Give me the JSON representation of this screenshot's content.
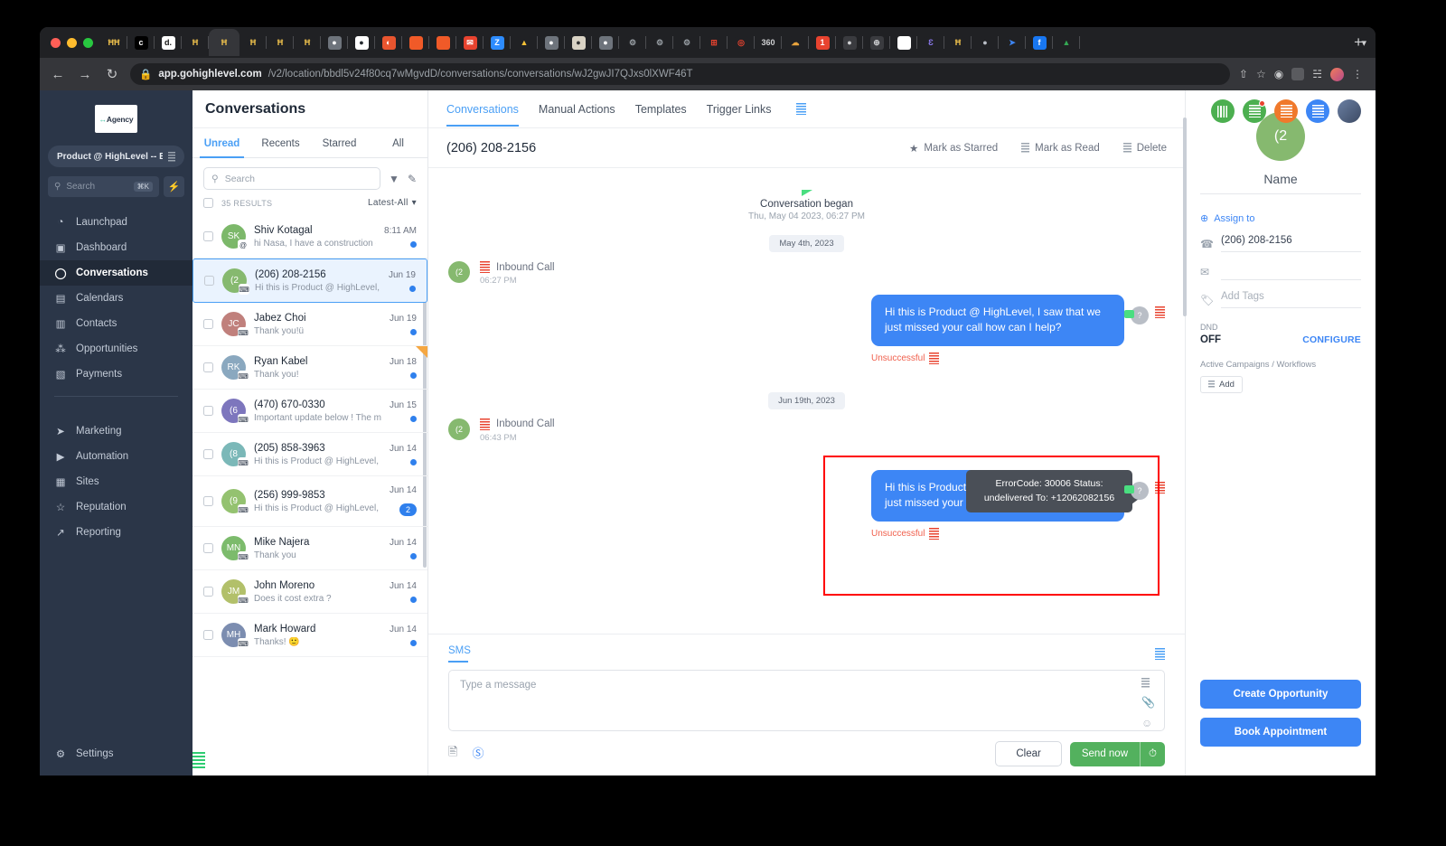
{
  "browser": {
    "url_domain": "app.gohighlevel.com",
    "url_path": "/v2/location/bbdl5v24f80cq7wMgvdD/conversations/conversations/wJ2gwJI7QJxs0lXWF46T",
    "back_icon": "back-arrow-icon",
    "forward_icon": "forward-arrow-icon",
    "reload_icon": "reload-icon",
    "lock_icon": "lock-icon",
    "new_tab_label": "+",
    "tab_list_chevron": "chevron-down-icon",
    "tabs": [
      {
        "name": "tab-tracker",
        "glyph": "ĦĦ",
        "bg": "#202124",
        "fg": "#f2c44d"
      },
      {
        "name": "tab-c",
        "glyph": "c",
        "bg": "#000000",
        "fg": "#ffffff"
      },
      {
        "name": "tab-d",
        "glyph": "d.",
        "bg": "#ffffff",
        "fg": "#111111"
      },
      {
        "name": "tab-highlevel-1",
        "glyph": "Ħ",
        "bg": "#202124",
        "fg": "#f2c44d"
      },
      {
        "name": "tab-highlevel-active",
        "glyph": "Ħ",
        "bg": "#35363a",
        "fg": "#f2c44d"
      },
      {
        "name": "tab-highlevel-2",
        "glyph": "Ħ",
        "bg": "#202124",
        "fg": "#f2c44d"
      },
      {
        "name": "tab-highlevel-3",
        "glyph": "Ħ",
        "bg": "#202124",
        "fg": "#f2c44d"
      },
      {
        "name": "tab-highlevel-4",
        "glyph": "Ħ",
        "bg": "#202124",
        "fg": "#f2c44d"
      },
      {
        "name": "tab-globe-1",
        "glyph": "●",
        "bg": "#6e747c",
        "fg": "#ffffff"
      },
      {
        "name": "tab-github",
        "glyph": "●",
        "bg": "#ffffff",
        "fg": "#24292e"
      },
      {
        "name": "tab-orange-leaf",
        "glyph": "◐",
        "bg": "#e8552f",
        "fg": "#ffffff"
      },
      {
        "name": "tab-orange-square",
        "glyph": "",
        "bg": "#f05a28",
        "fg": "#ffffff"
      },
      {
        "name": "tab-orange-square-2",
        "glyph": "",
        "bg": "#f05a28",
        "fg": "#ffffff"
      },
      {
        "name": "tab-mail",
        "glyph": "✉",
        "bg": "#e8432f",
        "fg": "#ffffff"
      },
      {
        "name": "tab-zoom",
        "glyph": "Z",
        "bg": "#2d8cff",
        "fg": "#ffffff"
      },
      {
        "name": "tab-firebase",
        "glyph": "▲",
        "bg": "#202124",
        "fg": "#f5c136"
      },
      {
        "name": "tab-globe-2",
        "glyph": "●",
        "bg": "#6e747c",
        "fg": "#ffffff"
      },
      {
        "name": "tab-jenkins",
        "glyph": "●",
        "bg": "#d9d2c4",
        "fg": "#333333"
      },
      {
        "name": "tab-globe-3",
        "glyph": "●",
        "bg": "#6e747c",
        "fg": "#ffffff"
      },
      {
        "name": "tab-gear-1",
        "glyph": "⚙",
        "bg": "#202124",
        "fg": "#9aa0a6"
      },
      {
        "name": "tab-gear-2",
        "glyph": "⚙",
        "bg": "#202124",
        "fg": "#9aa0a6"
      },
      {
        "name": "tab-gear-3",
        "glyph": "⚙",
        "bg": "#202124",
        "fg": "#9aa0a6"
      },
      {
        "name": "tab-grid-red",
        "glyph": "⊞",
        "bg": "#202124",
        "fg": "#e8432f"
      },
      {
        "name": "tab-target-red",
        "glyph": "◎",
        "bg": "#202124",
        "fg": "#e8432f"
      },
      {
        "name": "tab-360",
        "glyph": "360",
        "bg": "#202124",
        "fg": "#cfd0d2"
      },
      {
        "name": "tab-cloud",
        "glyph": "☁",
        "bg": "#202124",
        "fg": "#e8a33d"
      },
      {
        "name": "tab-notify",
        "glyph": "1",
        "bg": "#e8432f",
        "fg": "#ffffff"
      },
      {
        "name": "tab-speaker",
        "glyph": "●",
        "bg": "#3a3b3f",
        "fg": "#cfd0d2"
      },
      {
        "name": "tab-badge",
        "glyph": "⊕",
        "bg": "#3a3b3f",
        "fg": "#cfd0d2"
      },
      {
        "name": "tab-chat-white",
        "glyph": "●",
        "bg": "#ffffff",
        "fg": "#ffffff"
      },
      {
        "name": "tab-script-e",
        "glyph": "Ɛ",
        "bg": "#202124",
        "fg": "#8d7bf0"
      },
      {
        "name": "tab-highlevel-5",
        "glyph": "Ħ",
        "bg": "#202124",
        "fg": "#f2c44d"
      },
      {
        "name": "tab-apple",
        "glyph": "●",
        "bg": "#202124",
        "fg": "#b9bec6"
      },
      {
        "name": "tab-send-blue",
        "glyph": "➤",
        "bg": "#202124",
        "fg": "#3d86f5"
      },
      {
        "name": "tab-facebook",
        "glyph": "f",
        "bg": "#1877f2",
        "fg": "#ffffff"
      },
      {
        "name": "tab-gdrive",
        "glyph": "▲",
        "bg": "#202124",
        "fg": "#34a853"
      }
    ]
  },
  "sidebar": {
    "logo_prefix": "↔",
    "logo_text": "Agency",
    "account_label": "Product @ HighLevel -- E...",
    "search_placeholder": "Search",
    "search_shortcut": "⌘K",
    "bolt_icon": "lightning-bolt-icon",
    "items": [
      {
        "label": "Launchpad",
        "icon": "rocket-icon"
      },
      {
        "label": "Dashboard",
        "icon": "dashboard-grid-icon"
      },
      {
        "label": "Conversations",
        "icon": "chat-bubble-icon",
        "active": true
      },
      {
        "label": "Calendars",
        "icon": "calendar-icon"
      },
      {
        "label": "Contacts",
        "icon": "contacts-icon"
      },
      {
        "label": "Opportunities",
        "icon": "opportunities-icon"
      },
      {
        "label": "Payments",
        "icon": "payments-icon"
      }
    ],
    "items2": [
      {
        "label": "Marketing",
        "icon": "paper-plane-icon"
      },
      {
        "label": "Automation",
        "icon": "play-circle-icon"
      },
      {
        "label": "Sites",
        "icon": "sites-window-icon"
      },
      {
        "label": "Reputation",
        "icon": "star-icon"
      },
      {
        "label": "Reporting",
        "icon": "trending-up-icon"
      }
    ],
    "settings": {
      "label": "Settings",
      "icon": "gear-icon"
    }
  },
  "header": {
    "title": "Conversations",
    "tabs": [
      {
        "label": "Conversations",
        "active": true
      },
      {
        "label": "Manual Actions",
        "active": false
      },
      {
        "label": "Templates",
        "active": false
      },
      {
        "label": "Trigger Links",
        "active": false
      }
    ],
    "trigger_links_icon": "list-lines-icon",
    "top_icons": [
      {
        "name": "barcode-icon",
        "bg": "#4caf50"
      },
      {
        "name": "notes-notification-icon",
        "bg": "#4caf50",
        "dot": true
      },
      {
        "name": "document-orange-icon",
        "bg": "#f0792b"
      },
      {
        "name": "document-blue-icon",
        "bg": "#3d86f5"
      },
      {
        "name": "user-avatar",
        "bg": "#6b7fa3"
      }
    ]
  },
  "conversation_list": {
    "subtabs": [
      {
        "label": "Unread",
        "active": true
      },
      {
        "label": "Recents",
        "active": false
      },
      {
        "label": "Starred",
        "active": false
      },
      {
        "label": "All",
        "active": false
      }
    ],
    "search_placeholder": "Search",
    "filter_icon": "filter-funnel-icon",
    "compose_icon": "compose-pencil-icon",
    "results_count": "35 RESULTS",
    "sort_label": "Latest-All",
    "sort_chevron": "chevron-down-icon",
    "items": [
      {
        "initials": "SK",
        "color": "#7cb86a",
        "name": "Shiv Kotagal",
        "preview": "hi Nasa, I have a construction comp",
        "time": "8:11 AM",
        "unread_dot": true,
        "badge": "",
        "selected": false,
        "starred": false,
        "channel_icon": "at-sign-icon"
      },
      {
        "initials": "(2",
        "color": "#86b96f",
        "name": "(206) 208-2156",
        "preview": "Hi this is Product @ HighLevel, I saw",
        "time": "Jun 19",
        "unread_dot": true,
        "badge": "",
        "selected": true,
        "starred": false,
        "channel_icon": "sms-bubble-icon"
      },
      {
        "initials": "JC",
        "color": "#c0807c",
        "name": "Jabez Choi",
        "preview": "Thank you!ü",
        "time": "Jun 19",
        "unread_dot": true,
        "badge": "",
        "selected": false,
        "starred": false,
        "channel_icon": "sms-bubble-icon"
      },
      {
        "initials": "RK",
        "color": "#8aa8bf",
        "name": "Ryan Kabel",
        "preview": "Thank you!",
        "time": "Jun 18",
        "unread_dot": true,
        "badge": "",
        "selected": false,
        "starred": true,
        "channel_icon": "sms-bubble-icon"
      },
      {
        "initials": "(6",
        "color": "#7d76bd",
        "name": "(470) 670-0330",
        "preview": "Important update below ! The majo",
        "time": "Jun 15",
        "unread_dot": true,
        "badge": "",
        "selected": false,
        "starred": false,
        "channel_icon": "sms-bubble-icon"
      },
      {
        "initials": "(8",
        "color": "#7bb8b8",
        "name": "(205) 858-3963",
        "preview": "Hi this is Product @ HighLevel, I saw",
        "time": "Jun 14",
        "unread_dot": true,
        "badge": "",
        "selected": false,
        "starred": false,
        "channel_icon": "sms-bubble-icon"
      },
      {
        "initials": "(9",
        "color": "#94c270",
        "name": "(256) 999-9853",
        "preview": "Hi this is Product @ HighLevel, I saw",
        "time": "Jun 14",
        "unread_dot": false,
        "badge": "2",
        "selected": false,
        "starred": false,
        "channel_icon": "sms-bubble-icon"
      },
      {
        "initials": "MN",
        "color": "#7cbb6c",
        "name": "Mike Najera",
        "preview": "Thank you",
        "time": "Jun 14",
        "unread_dot": true,
        "badge": "",
        "selected": false,
        "starred": false,
        "channel_icon": "sms-bubble-icon"
      },
      {
        "initials": "JM",
        "color": "#b2c06a",
        "name": "John Moreno",
        "preview": "Does it cost extra ?",
        "time": "Jun 14",
        "unread_dot": true,
        "badge": "",
        "selected": false,
        "starred": false,
        "channel_icon": "sms-bubble-icon"
      },
      {
        "initials": "MH",
        "color": "#7c8db0",
        "name": "Mark Howard",
        "preview": "Thanks! 🙂",
        "time": "Jun 14",
        "unread_dot": true,
        "badge": "",
        "selected": false,
        "starred": false,
        "channel_icon": "sms-bubble-icon"
      }
    ]
  },
  "thread": {
    "title": "(206) 208-2156",
    "actions": [
      {
        "label": "Mark as Starred",
        "icon": "star-filled-icon"
      },
      {
        "label": "Mark as Read",
        "icon": "lines-icon"
      },
      {
        "label": "Delete",
        "icon": "lines-icon"
      }
    ],
    "began_title": "Conversation began",
    "began_sub": "Thu, May 04 2023, 06:27 PM",
    "date_1": "May 4th, 2023",
    "date_2": "Jun 19th, 2023",
    "call_1": {
      "label": "Inbound Call",
      "time": "06:27 PM",
      "initials": "(2"
    },
    "call_2": {
      "label": "Inbound Call",
      "time": "06:43 PM",
      "initials": "(2"
    },
    "message_text": "Hi this is Product @ HighLevel, I saw that we just missed your call how can I help?",
    "status_label": "Unsuccessful",
    "tooltip_line1": "ErrorCode: 30006 Status:",
    "tooltip_line2": "undelivered To: +12062082156",
    "status_avatar_glyph": "?",
    "highlight_color": "#ff0000"
  },
  "composer": {
    "channel_tab": "SMS",
    "placeholder": "Type a message",
    "template_icon": "lines-icon",
    "attach_icon": "paperclip-icon",
    "emoji_icon": "emoji-smiley-icon",
    "snippet_icon": "document-icon",
    "payment_icon": "dollar-circle-icon",
    "clear_label": "Clear",
    "send_label": "Send now",
    "schedule_icon": "clock-icon"
  },
  "right_panel": {
    "avatar_initials": "(2",
    "name_label": "Name",
    "assign_label": "Assign to",
    "assign_icon": "plus-circle-icon",
    "phone_icon": "phone-icon",
    "phone_value": "(206) 208-2156",
    "email_icon": "envelope-icon",
    "email_value": "",
    "tags_icon": "tag-icon",
    "tags_placeholder": "Add Tags",
    "dnd_label": "DND",
    "dnd_value": "OFF",
    "configure_label": "CONFIGURE",
    "campaigns_label": "Active Campaigns / Workflows",
    "add_label": "Add",
    "add_icon": "lines-icon",
    "create_opportunity_label": "Create Opportunity",
    "book_appointment_label": "Book Appointment"
  }
}
